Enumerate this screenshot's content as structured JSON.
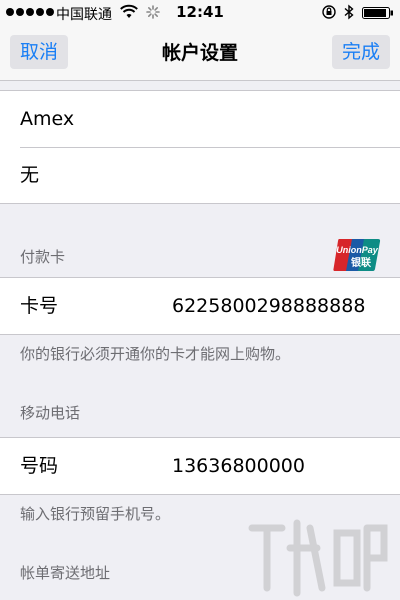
{
  "status_bar": {
    "carrier": "中国联通",
    "time": "12:41"
  },
  "nav": {
    "cancel_label": "取消",
    "title": "帐户设置",
    "done_label": "完成"
  },
  "top_rows": [
    {
      "label": "Amex"
    },
    {
      "label": "无"
    }
  ],
  "payment_card": {
    "header": "付款卡",
    "card_label": "卡号",
    "card_number": "6225800298888888",
    "note": "你的银行必须开通你的卡才能网上购物。",
    "logo_text": "UnionPay 银联"
  },
  "mobile": {
    "header": "移动电话",
    "phone_label": "号码",
    "phone_number": "13636800000",
    "note": "输入银行预留手机号。"
  },
  "billing": {
    "header": "帐单寄送地址"
  },
  "colors": {
    "accent": "#1a7ff5",
    "background": "#efeff4",
    "separator": "#c8c7cc",
    "unionpay_red": "#d7262a",
    "unionpay_blue": "#1b5aa6",
    "unionpay_green": "#0e8c85"
  }
}
